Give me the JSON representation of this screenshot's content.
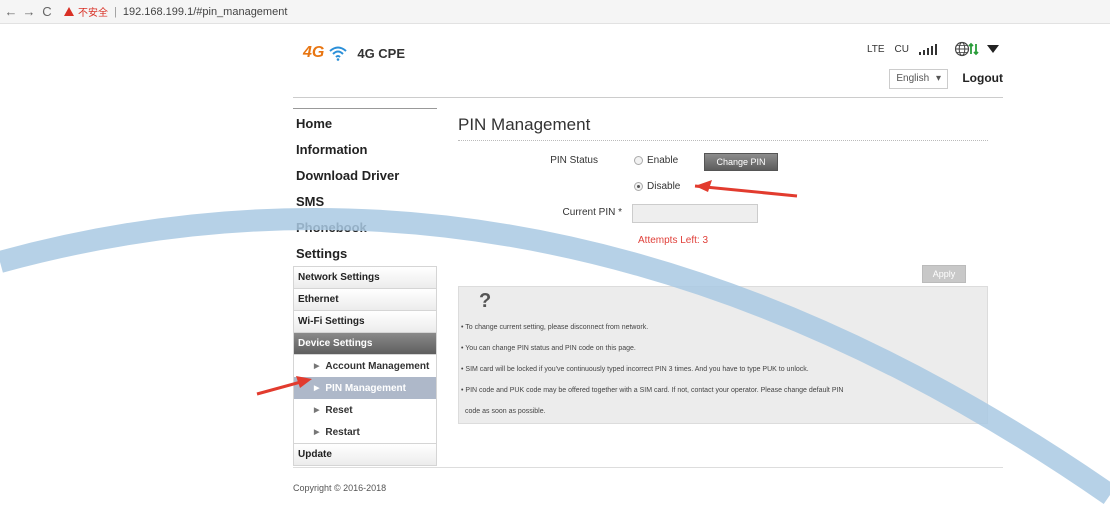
{
  "browser": {
    "back": "←",
    "forward": "→",
    "reload": "C",
    "security_text": "不安全",
    "separator": "|",
    "url": "192.168.199.1/#pin_management"
  },
  "header": {
    "logo_badge": "4G",
    "product_name": "4G CPE",
    "status_lte": "LTE",
    "status_cu": "CU",
    "language_selected": "English",
    "language_caret": "▾",
    "logout": "Logout"
  },
  "sidebar": {
    "top_items": [
      {
        "label": "Home"
      },
      {
        "label": "Information"
      },
      {
        "label": "Download Driver"
      },
      {
        "label": "SMS"
      },
      {
        "label": "Phonebook"
      },
      {
        "label": "Settings"
      }
    ],
    "settings_items": [
      {
        "label": "Network Settings"
      },
      {
        "label": "Ethernet"
      },
      {
        "label": "Wi-Fi Settings"
      },
      {
        "label": "Device Settings"
      }
    ],
    "device_items": [
      {
        "label": "Account Management"
      },
      {
        "label": "PIN Management"
      },
      {
        "label": "Reset"
      },
      {
        "label": "Restart"
      }
    ],
    "bottom_item": "Update",
    "tri": "▶"
  },
  "main": {
    "title": "PIN Management",
    "pin_status_label": "PIN Status",
    "enable_label": "Enable",
    "disable_label": "Disable",
    "selected": "Disable",
    "change_pin_button": "Change PIN",
    "current_pin_label": "Current PIN *",
    "current_pin_value": "",
    "attempts_left": "Attempts Left: 3",
    "apply_button": "Apply",
    "help_icon": "?",
    "help_lines": [
      "• To change current setting, please disconnect from network.",
      "• You can change PIN status and PIN code on this page.",
      "• SIM card will be locked if you've continuously typed incorrect PIN 3 times. And you have to type PUK to unlock.",
      "• PIN code and PUK code may be offered together with a SIM card. If not, contact your operator. Please change default PIN",
      "code as soon as possible."
    ]
  },
  "footer": {
    "copyright": "Copyright © 2016-2018"
  },
  "colors": {
    "annotation_arrow": "#e23b2e",
    "decorative_arc": "#a9c9e3",
    "active_menu": "#aeb8c9",
    "brand_orange": "#e87511"
  }
}
